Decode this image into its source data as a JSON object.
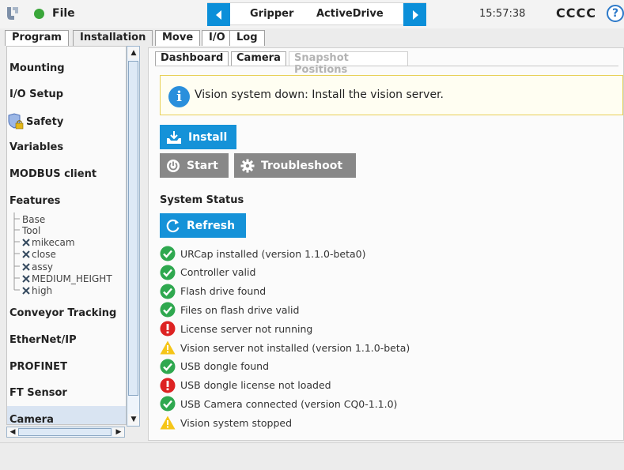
{
  "topbar": {
    "file_label": "File",
    "program_name": "Gripper",
    "program_variant": "ActiveDrive",
    "time": "15:57:38",
    "robot_name": "CCCC",
    "help_label": "?"
  },
  "main_tabs": [
    "Program",
    "Installation",
    "Move",
    "I/O",
    "Log"
  ],
  "sidebar": {
    "items": [
      "Mounting",
      "I/O Setup",
      "Safety",
      "Variables",
      "MODBUS client",
      "Features",
      "Conveyor Tracking",
      "EtherNet/IP",
      "PROFINET",
      "FT Sensor",
      "Camera"
    ],
    "features": [
      "Base",
      "Tool",
      "mikecam",
      "close",
      "assy",
      "MEDIUM_HEIGHT",
      "high"
    ]
  },
  "sub_tabs": [
    "Dashboard",
    "Camera",
    "Snapshot Positions"
  ],
  "banner": {
    "icon": "i",
    "message": "Vision system down: Install the vision server."
  },
  "buttons": {
    "install": "Install",
    "start": "Start",
    "troubleshoot": "Troubleshoot",
    "refresh": "Refresh"
  },
  "status_heading": "System Status",
  "status_items": [
    {
      "text": "URCap installed (version 1.1.0-beta0)",
      "state": "ok"
    },
    {
      "text": "Controller valid",
      "state": "ok"
    },
    {
      "text": "Flash drive found",
      "state": "ok"
    },
    {
      "text": "Files on flash drive valid",
      "state": "ok"
    },
    {
      "text": "License server not running",
      "state": "error"
    },
    {
      "text": "Vision server not installed (version 1.1.0-beta)",
      "state": "warning"
    },
    {
      "text": "USB dongle found",
      "state": "ok"
    },
    {
      "text": "USB dongle license not loaded",
      "state": "error"
    },
    {
      "text": "USB Camera connected (version CQ0-1.1.0)",
      "state": "ok"
    },
    {
      "text": "Vision system stopped",
      "state": "warning"
    }
  ],
  "colors": {
    "accent": "#1592d8",
    "ok": "#2fa84f",
    "error": "#dd2222",
    "warning": "#f5c518"
  }
}
